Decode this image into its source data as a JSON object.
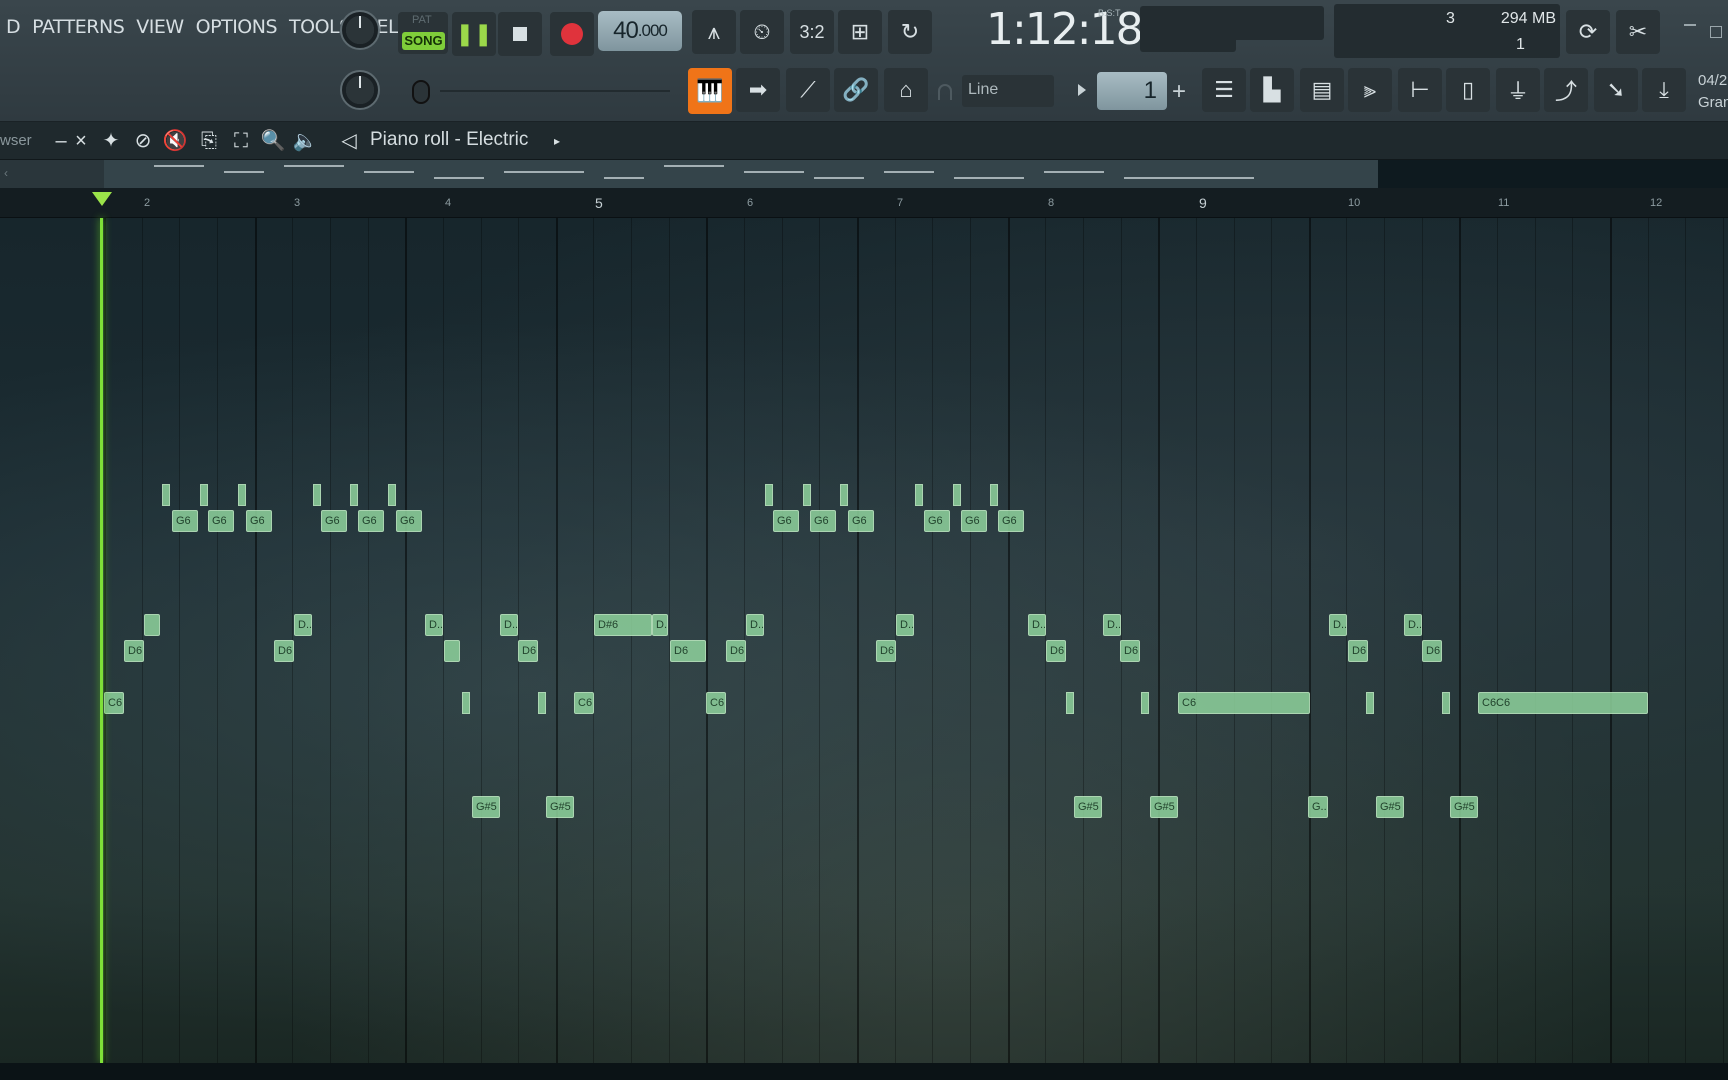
{
  "menu": [
    "D",
    "PATTERNS",
    "VIEW",
    "OPTIONS",
    "TOOLS",
    "HELP"
  ],
  "transport": {
    "pat_label": "PAT",
    "song_label": "SONG",
    "tempo_whole": "40",
    "tempo_frac": ".000",
    "time_display": "1:12:18",
    "time_unit": "B:S:T"
  },
  "monitor": {
    "cpu": "3",
    "memory": "294 MB",
    "polyphony": "1"
  },
  "tools": {
    "snap_label": "Line",
    "step_value": "1",
    "date_partial": "04/2",
    "gran_partial": "Gran"
  },
  "piano_roll": {
    "browser_label": "wser",
    "title": "Piano roll - Electric"
  },
  "ruler": [
    "2",
    "3",
    "4",
    "5",
    "6",
    "7",
    "8",
    "9",
    "10",
    "11",
    "12"
  ],
  "notes": [
    {
      "label": "G6"
    },
    {
      "label": "G6"
    },
    {
      "label": "G6"
    },
    {
      "label": "G6"
    },
    {
      "label": "G6"
    },
    {
      "label": "G6"
    },
    {
      "label": "G6"
    },
    {
      "label": "G6"
    },
    {
      "label": "G6"
    },
    {
      "label": "G6"
    },
    {
      "label": "G6"
    },
    {
      "label": "G6"
    },
    {
      "label": "D..."
    },
    {
      "label": "D6"
    },
    {
      "label": "D..."
    },
    {
      "label": "D6"
    },
    {
      "label": "D..."
    },
    {
      "label": "D..."
    },
    {
      "label": "D6"
    },
    {
      "label": "D#6"
    },
    {
      "label": "D6"
    },
    {
      "label": "D6"
    },
    {
      "label": "D..."
    },
    {
      "label": "D..."
    },
    {
      "label": "D6"
    },
    {
      "label": "D..."
    },
    {
      "label": "D6"
    },
    {
      "label": "D..."
    },
    {
      "label": "D6"
    },
    {
      "label": "D..."
    },
    {
      "label": "D6"
    },
    {
      "label": "D..."
    },
    {
      "label": "D6"
    },
    {
      "label": "D..."
    },
    {
      "label": "D6"
    },
    {
      "label": "C6"
    },
    {
      "label": "C6"
    },
    {
      "label": "C6"
    },
    {
      "label": "C6"
    },
    {
      "label": "C6C6"
    },
    {
      "label": "G#5"
    },
    {
      "label": "G#5"
    },
    {
      "label": "G#5"
    },
    {
      "label": "G#5"
    },
    {
      "label": "G..."
    },
    {
      "label": "G#5"
    },
    {
      "label": "G#5"
    }
  ]
}
